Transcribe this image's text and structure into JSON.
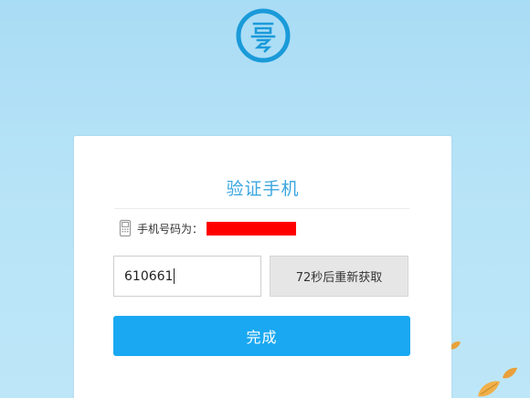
{
  "logo": {
    "icon": "ji-seal-logo-icon",
    "color": "#1a9ad9"
  },
  "card": {
    "title": "验证手机",
    "phone_label": "手机号码为：",
    "phone_icon": "mobile-phone-icon",
    "phone_masked_color": "#ff0000",
    "code_value": "610661",
    "resend_label": "72秒后重新获取",
    "done_label": "完成"
  },
  "colors": {
    "accent": "#1aa8f2",
    "title": "#3ba6e0",
    "background": "#b7e3f7"
  }
}
